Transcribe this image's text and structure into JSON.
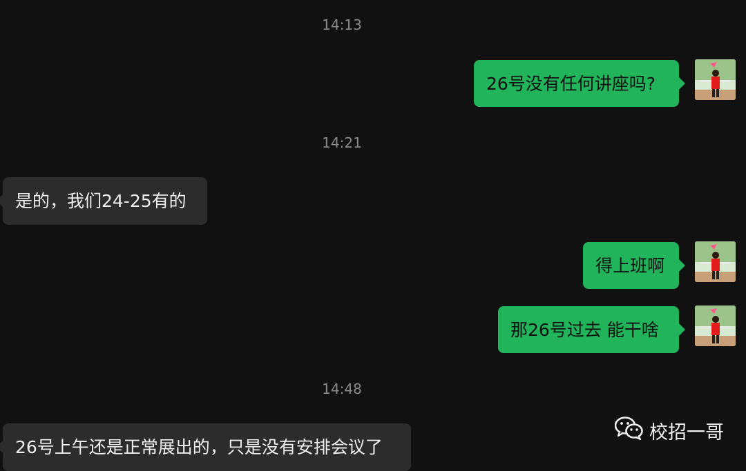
{
  "messages": [
    {
      "type": "time",
      "text": "14:13"
    },
    {
      "type": "out",
      "text": "26号没有任何讲座吗?"
    },
    {
      "type": "time",
      "text": "14:21"
    },
    {
      "type": "in",
      "text": "是的，我们24-25有的"
    },
    {
      "type": "out",
      "text": "得上班啊"
    },
    {
      "type": "out",
      "text": "那26号过去 能干啥"
    },
    {
      "type": "time",
      "text": "14:48"
    },
    {
      "type": "in",
      "text": "26号上午还是正常展出的，只是没有安排会议了"
    }
  ],
  "watermark": {
    "icon": "wechat-icon",
    "text": "校招一哥"
  },
  "colors": {
    "background": "#111111",
    "outgoing_bubble": "#22b45a",
    "incoming_bubble": "#2c2c2c"
  }
}
